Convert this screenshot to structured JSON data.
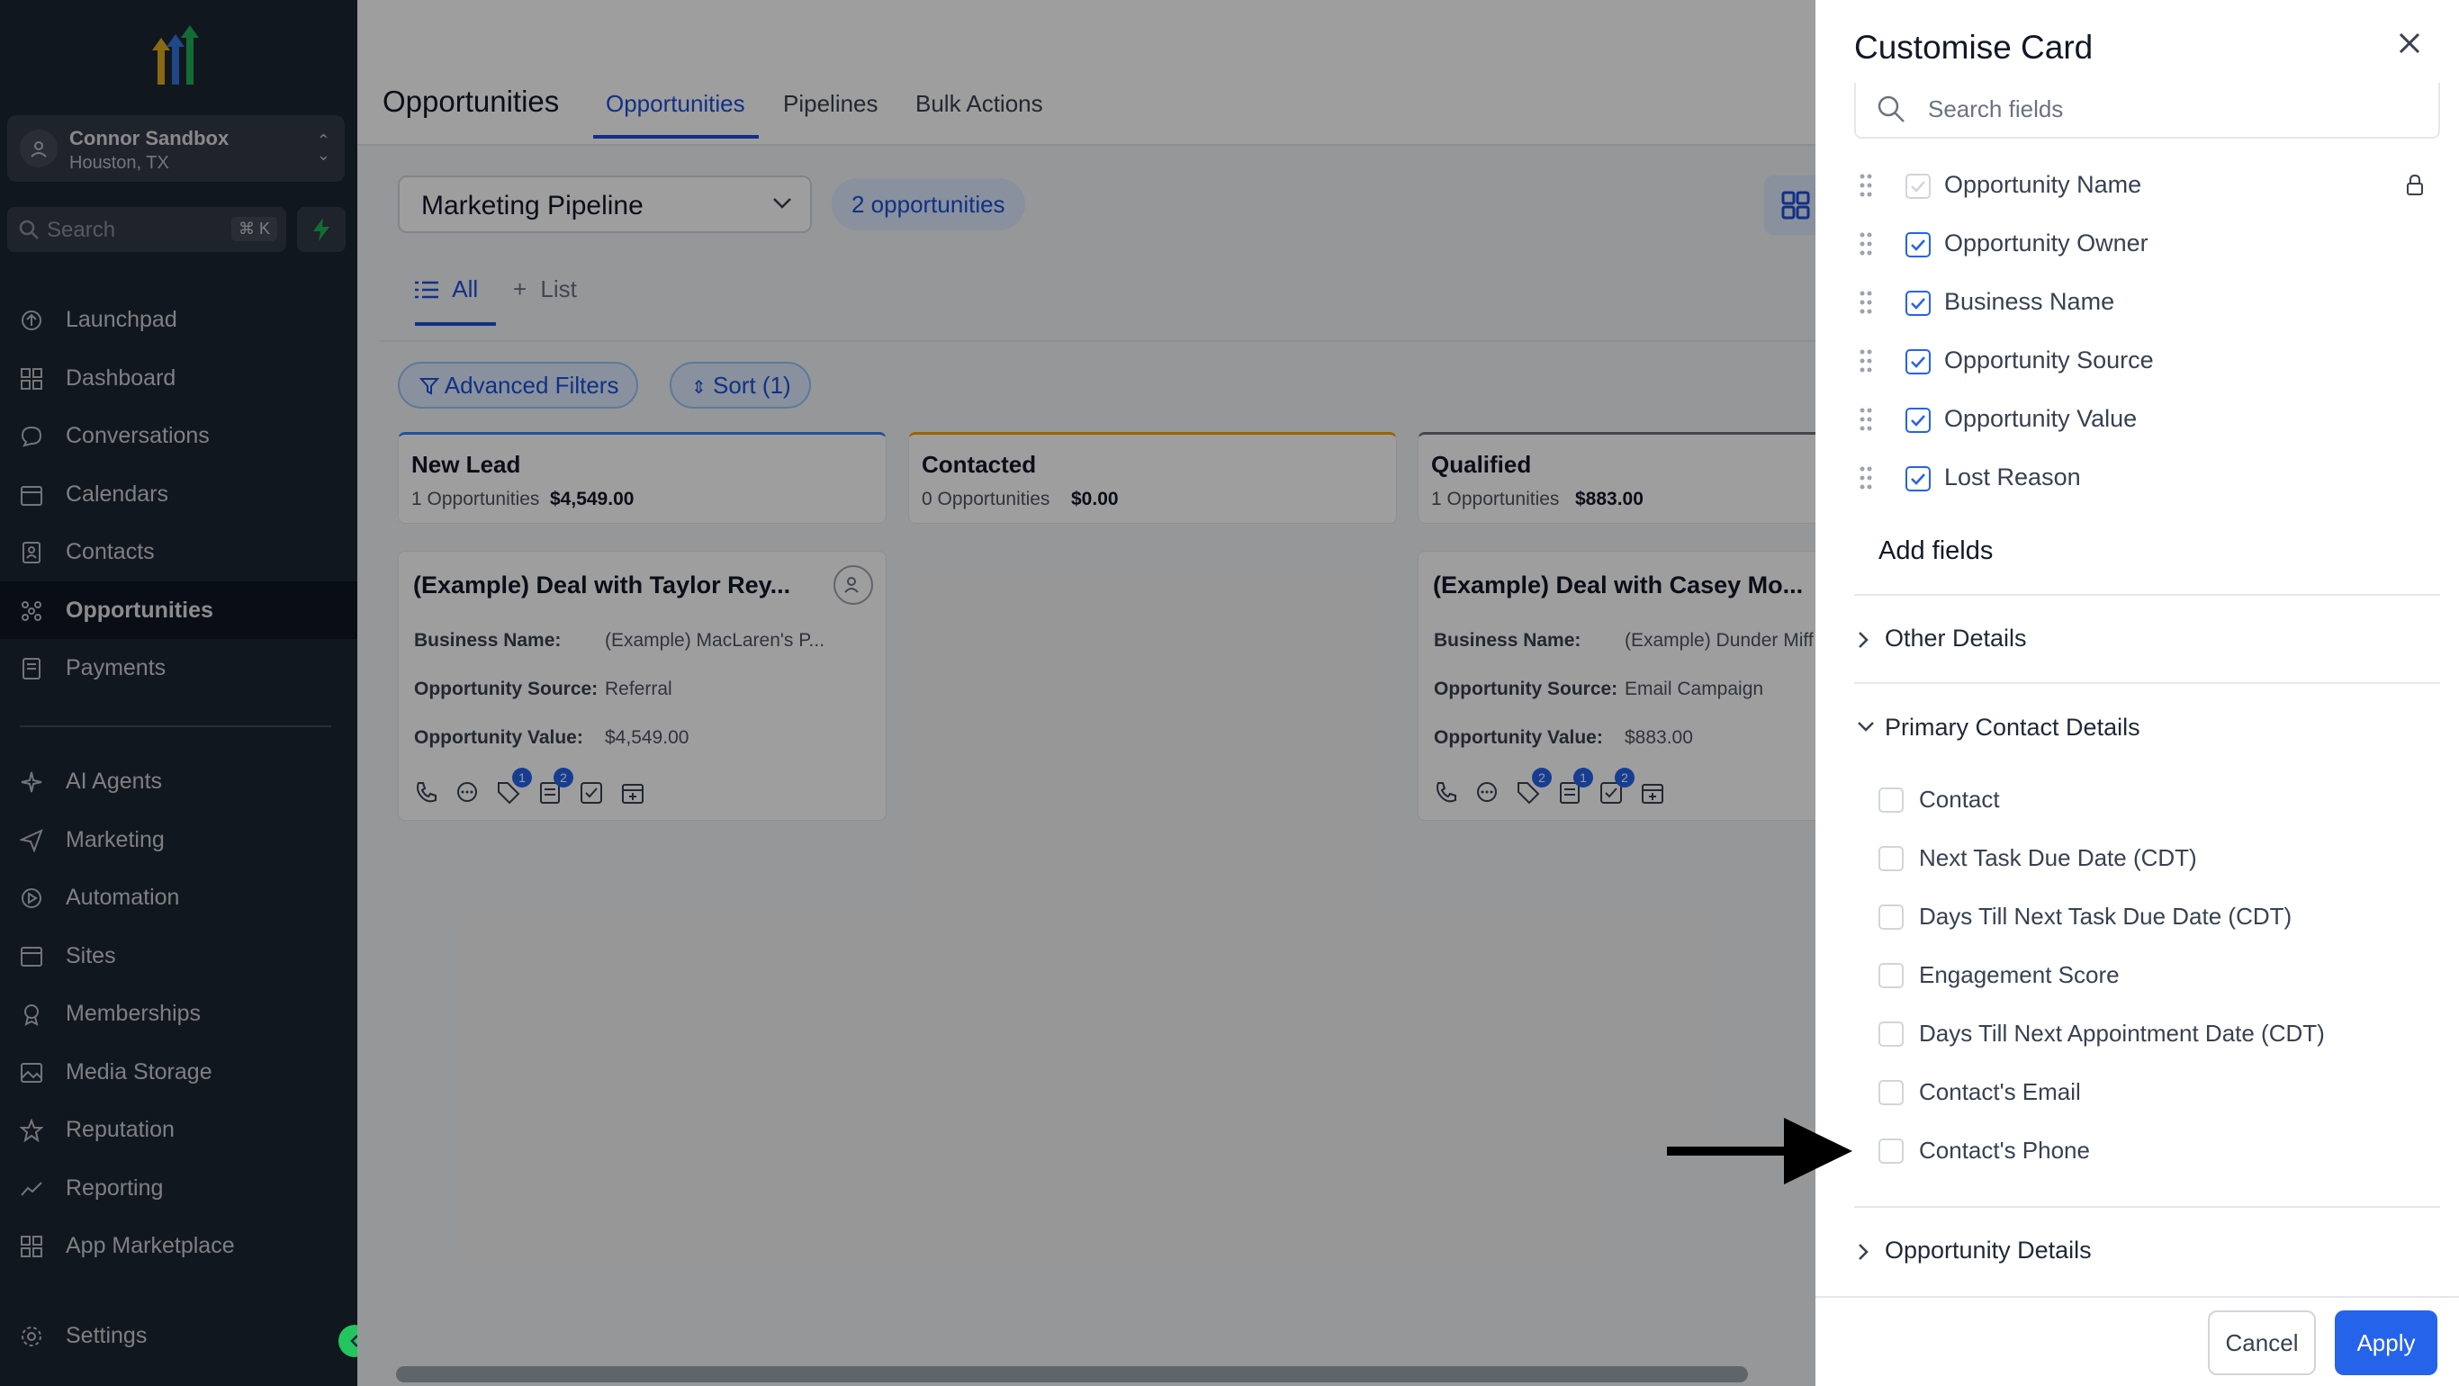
{
  "account": {
    "name": "Connor Sandbox",
    "location": "Houston, TX"
  },
  "search": {
    "placeholder": "Search",
    "shortcut": "⌘ K"
  },
  "sidebar": {
    "items": [
      {
        "label": "Launchpad",
        "icon": "launchpad-icon"
      },
      {
        "label": "Dashboard",
        "icon": "dashboard-icon"
      },
      {
        "label": "Conversations",
        "icon": "chat-icon"
      },
      {
        "label": "Calendars",
        "icon": "calendar-icon"
      },
      {
        "label": "Contacts",
        "icon": "contacts-icon"
      },
      {
        "label": "Opportunities",
        "icon": "opportunities-icon",
        "active": true
      },
      {
        "label": "Payments",
        "icon": "payments-icon"
      }
    ],
    "items2": [
      {
        "label": "AI Agents",
        "icon": "ai-agents-icon"
      },
      {
        "label": "Marketing",
        "icon": "send-icon"
      },
      {
        "label": "Automation",
        "icon": "automation-icon"
      },
      {
        "label": "Sites",
        "icon": "sites-icon"
      },
      {
        "label": "Memberships",
        "icon": "memberships-icon"
      },
      {
        "label": "Media Storage",
        "icon": "image-icon"
      },
      {
        "label": "Reputation",
        "icon": "star-icon"
      },
      {
        "label": "Reporting",
        "icon": "chart-line-icon"
      },
      {
        "label": "App Marketplace",
        "icon": "apps-grid-icon"
      }
    ],
    "settings": "Settings"
  },
  "header": {
    "title": "Opportunities",
    "tabs": [
      "Opportunities",
      "Pipelines",
      "Bulk Actions"
    ]
  },
  "pipeline": {
    "selected": "Marketing Pipeline",
    "count": "2 opportunities"
  },
  "subtabs": {
    "all": "All",
    "list": "List"
  },
  "filters": {
    "advanced": "Advanced Filters",
    "sort": "Sort (1)"
  },
  "columns": [
    {
      "title": "New Lead",
      "count": "1 Opportunities",
      "amount": "$4,549.00"
    },
    {
      "title": "Contacted",
      "count": "0 Opportunities",
      "amount": "$0.00"
    },
    {
      "title": "Qualified",
      "count": "1 Opportunities",
      "amount": "$883.00"
    }
  ],
  "cards": [
    {
      "title": "(Example) Deal with Taylor Rey...",
      "business_label": "Business Name:",
      "business": "(Example) MacLaren's P...",
      "source_label": "Opportunity Source:",
      "source": "Referral",
      "value_label": "Opportunity Value:",
      "value": "$4,549.00",
      "badges": {
        "tasks": "1",
        "notes": "2"
      }
    },
    {
      "title": "(Example) Deal with Casey Mo...",
      "business_label": "Business Name:",
      "business": "(Example) Dunder Miff",
      "source_label": "Opportunity Source:",
      "source": "Email Campaign",
      "value_label": "Opportunity Value:",
      "value": "$883.00",
      "badges": {
        "tags": "2",
        "tasks": "1",
        "notes": "2"
      }
    }
  ],
  "drawer": {
    "title": "Customise Card",
    "search_placeholder": "Search fields",
    "selected_fields": [
      {
        "label": "Opportunity Name",
        "locked": true
      },
      {
        "label": "Opportunity Owner"
      },
      {
        "label": "Business Name"
      },
      {
        "label": "Opportunity Source"
      },
      {
        "label": "Opportunity Value"
      },
      {
        "label": "Lost Reason"
      }
    ],
    "add_fields": "Add fields",
    "sections": {
      "other": "Other Details",
      "primary": "Primary Contact Details",
      "opportunity": "Opportunity Details"
    },
    "primary_fields": [
      "Contact",
      "Next Task Due Date (CDT)",
      "Days Till Next Task Due Date (CDT)",
      "Engagement Score",
      "Days Till Next Appointment Date (CDT)",
      "Contact's Email",
      "Contact's Phone"
    ],
    "cancel": "Cancel",
    "apply": "Apply"
  },
  "colors": {
    "accent": "#2563eb",
    "sidebar": "#1f2a37",
    "pill": "#dbeafe"
  }
}
